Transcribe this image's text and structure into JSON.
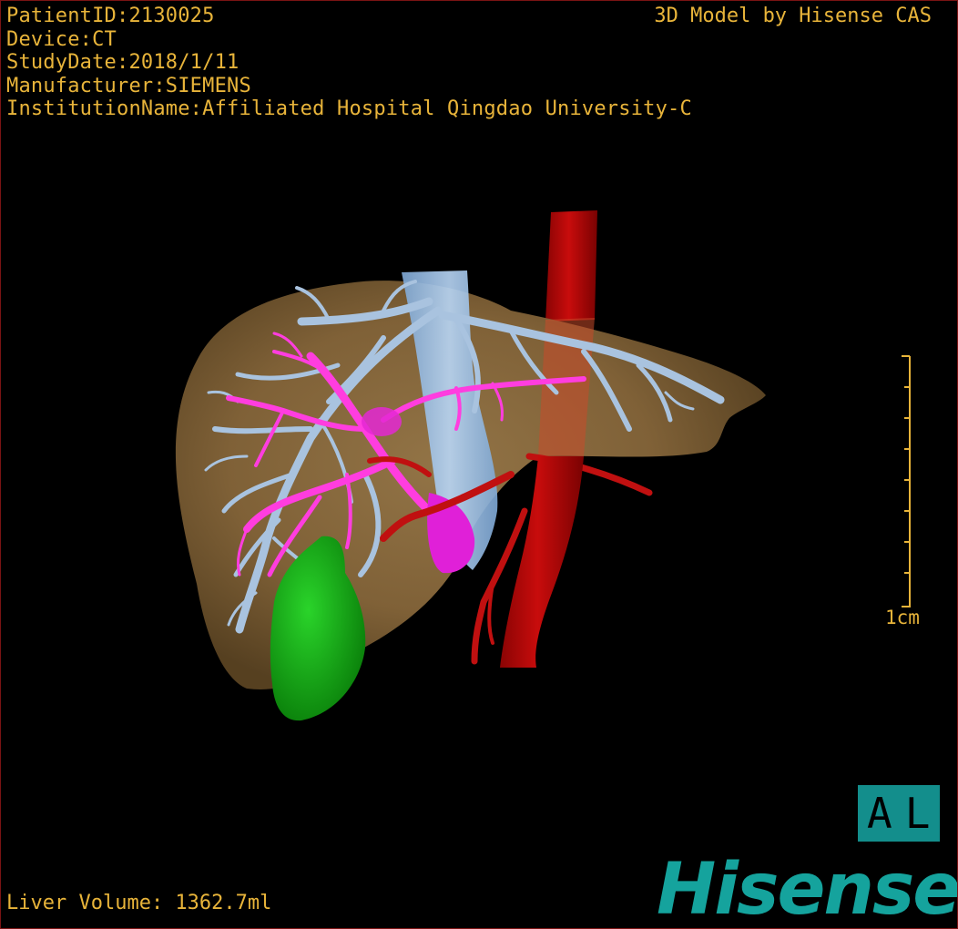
{
  "overlay": {
    "patient_id": "PatientID:2130025",
    "device": "Device:CT",
    "study_date": "StudyDate:2018/1/11",
    "manufacturer": "Manufacturer:SIEMENS",
    "institution": "InstitutionName:Affiliated Hospital Qingdao University-C",
    "credit": "3D Model by Hisense CAS",
    "volume": "Liver Volume: 1362.7ml"
  },
  "scale_bar": {
    "label": "1cm",
    "ticks": 9
  },
  "orientation": {
    "label": "AL"
  },
  "brand": {
    "logo_text": "Hisense"
  },
  "colors": {
    "overlay_text": "#e8b43a",
    "brand": "#15a39d",
    "liver": "#8a6a3e",
    "hepatic_vein": "#a8c2de",
    "portal_vein": "#ff3ddf",
    "aorta": "#b30808",
    "gallbladder": "#10b010",
    "vena_cava": "#9ec7ee",
    "frame": "#7a1414"
  }
}
